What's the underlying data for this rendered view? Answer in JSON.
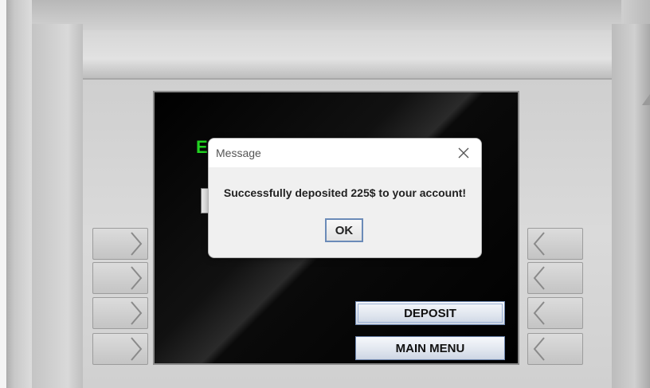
{
  "screen": {
    "heading_partial": "E",
    "deposit_button": "DEPOSIT",
    "main_menu_button": "MAIN MENU"
  },
  "dialog": {
    "title": "Message",
    "message": "Successfully deposited 225$ to your account!",
    "ok_label": "OK",
    "close_icon": "close-icon"
  },
  "side_keys": {
    "left_icon": "chevron-right-icon",
    "right_icon": "chevron-left-icon",
    "count_per_side": 4
  },
  "colors": {
    "heading_green": "#21d321",
    "screen_bg": "#000000",
    "button_border": "#6d85ad"
  }
}
